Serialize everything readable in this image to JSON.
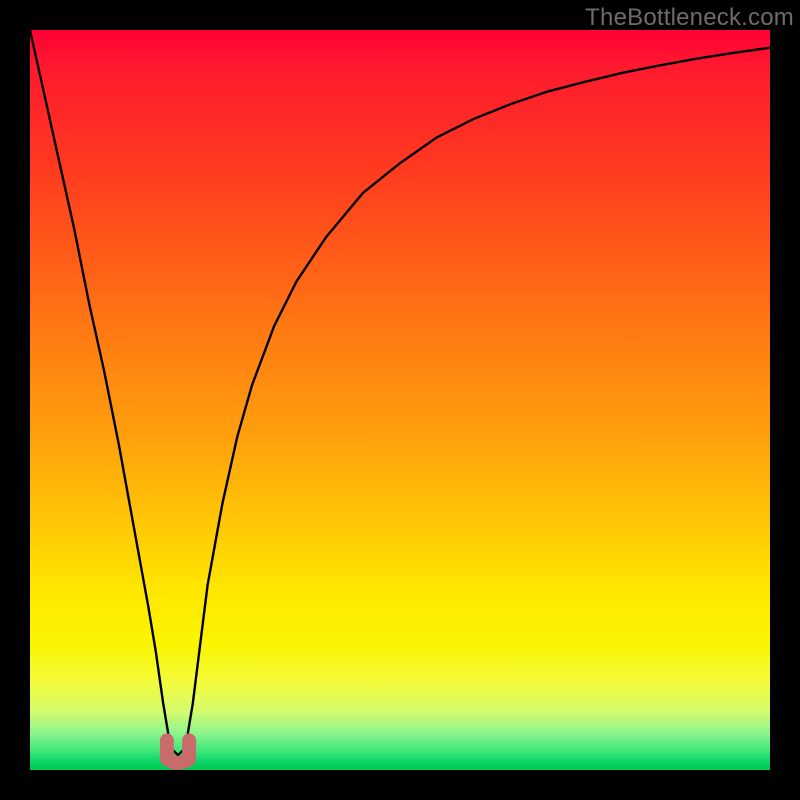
{
  "watermark": "TheBottleneck.com",
  "chart_data": {
    "type": "line",
    "title": "",
    "xlabel": "",
    "ylabel": "",
    "xlim": [
      0,
      100
    ],
    "ylim": [
      0,
      100
    ],
    "background_gradient": {
      "direction": "vertical",
      "stops": [
        {
          "pos": 0,
          "color": "#ff0033"
        },
        {
          "pos": 18,
          "color": "#ff3820"
        },
        {
          "pos": 42,
          "color": "#ff7d12"
        },
        {
          "pos": 67,
          "color": "#ffc806"
        },
        {
          "pos": 83,
          "color": "#fbf500"
        },
        {
          "pos": 95,
          "color": "#8ef58e"
        },
        {
          "pos": 100,
          "color": "#00c853"
        }
      ]
    },
    "series": [
      {
        "name": "bottleneck-curve",
        "color": "#000000",
        "stroke_width": 2,
        "x": [
          0,
          2,
          4,
          6,
          8,
          10,
          12,
          14,
          16,
          17,
          18,
          19,
          20,
          21,
          22,
          23,
          24,
          26,
          28,
          30,
          33,
          36,
          40,
          45,
          50,
          55,
          60,
          65,
          70,
          75,
          80,
          85,
          90,
          95,
          100
        ],
        "y": [
          100,
          91,
          82,
          73,
          63,
          54,
          44,
          33,
          22,
          16,
          9,
          3,
          2,
          3,
          9,
          17,
          25,
          36,
          45,
          52,
          60,
          66,
          72,
          78,
          82,
          85.5,
          88,
          90,
          91.7,
          93,
          94.2,
          95.2,
          96.1,
          96.9,
          97.6
        ]
      }
    ],
    "marker": {
      "name": "min-point-marker",
      "shape": "u",
      "color": "#c96b6b",
      "x_range": [
        18.5,
        21.5
      ],
      "y_range": [
        0,
        4
      ]
    }
  }
}
